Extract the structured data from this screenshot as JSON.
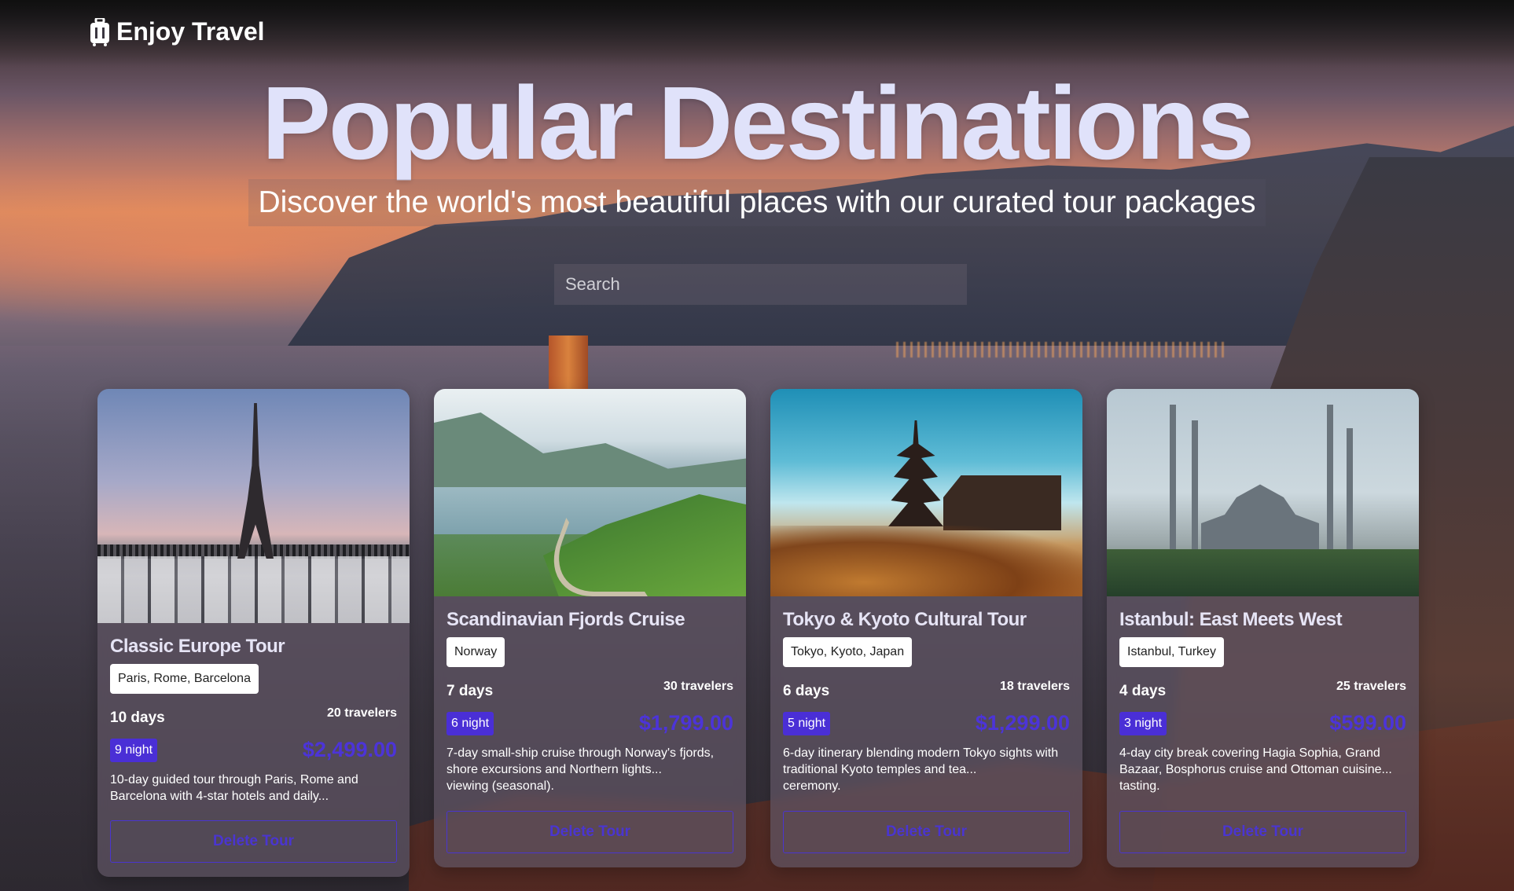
{
  "brand": {
    "name": "Enjoy Travel",
    "icon": "suitcase-icon"
  },
  "hero": {
    "title": "Popular Destinations",
    "subtitle": "Discover the world's most beautiful places with our curated tour packages"
  },
  "search": {
    "placeholder": "Search",
    "value": ""
  },
  "colors": {
    "accent": "#4a2fd6",
    "title": "#e0e2fa"
  },
  "tours": [
    {
      "title": "Classic Europe Tour",
      "location": "Paris, Rome, Barcelona",
      "days": "10 days",
      "travelers": "20 travelers",
      "nights": "9 night",
      "price": "$2,499.00",
      "description": "10-day guided tour through Paris, Rome and Barcelona with 4-star hotels and daily...",
      "delete_label": "Delete Tour",
      "image": "eiffel-tower-photo"
    },
    {
      "title": "Scandinavian Fjords Cruise",
      "location": "Norway",
      "days": "7 days",
      "travelers": "30 travelers",
      "nights": "6 night",
      "price": "$1,799.00",
      "description": "7-day small-ship cruise through Norway's fjords, shore excursions and Northern lights...",
      "description_extra": "viewing (seasonal).",
      "delete_label": "Delete Tour",
      "image": "norway-fjord-photo"
    },
    {
      "title": "Tokyo & Kyoto Cultural Tour",
      "location": "Tokyo, Kyoto, Japan",
      "days": "6 days",
      "travelers": "18 travelers",
      "nights": "5 night",
      "price": "$1,299.00",
      "description": "6-day itinerary blending modern Tokyo sights with traditional Kyoto temples and tea...",
      "description_extra": "ceremony.",
      "delete_label": "Delete Tour",
      "image": "kyoto-pagoda-photo"
    },
    {
      "title": "Istanbul: East Meets West",
      "location": "Istanbul, Turkey",
      "days": "4 days",
      "travelers": "25 travelers",
      "nights": "3 night",
      "price": "$599.00",
      "description": "4-day city break covering Hagia Sophia, Grand Bazaar, Bosphorus cruise and Ottoman cuisine...",
      "description_extra": "tasting.",
      "delete_label": "Delete Tour",
      "image": "istanbul-mosque-photo"
    }
  ]
}
